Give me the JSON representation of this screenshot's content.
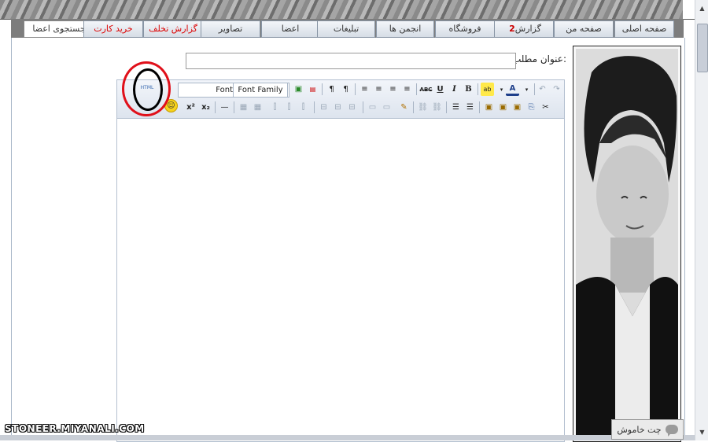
{
  "nav": {
    "search_members": "جستجوی اعضا",
    "tabs": [
      {
        "label": "صفحه اصلی"
      },
      {
        "label": "صفحه من"
      },
      {
        "label": "گزارش",
        "badge": "2"
      },
      {
        "label": "فروشگاه"
      },
      {
        "label": "انجمن ها"
      },
      {
        "label": "تبلیغات"
      },
      {
        "label": "اعضا"
      },
      {
        "label": "تصاویر"
      },
      {
        "label": "گزارش تخلف"
      },
      {
        "label": "خرید کارت شارژ"
      }
    ]
  },
  "form": {
    "title_label": "عنوان مطلب:",
    "title_value": ""
  },
  "toolbar": {
    "html_button": "HTML",
    "font_size": "Font Size",
    "font_family": "Font Family"
  },
  "chat": {
    "label": "چت خاموش"
  },
  "watermark": "STONEER.MIYANALI.COM",
  "colors": {
    "annotation_red": "#e0101a",
    "annotation_black": "#000000",
    "nav_alert": "#cc0000"
  }
}
